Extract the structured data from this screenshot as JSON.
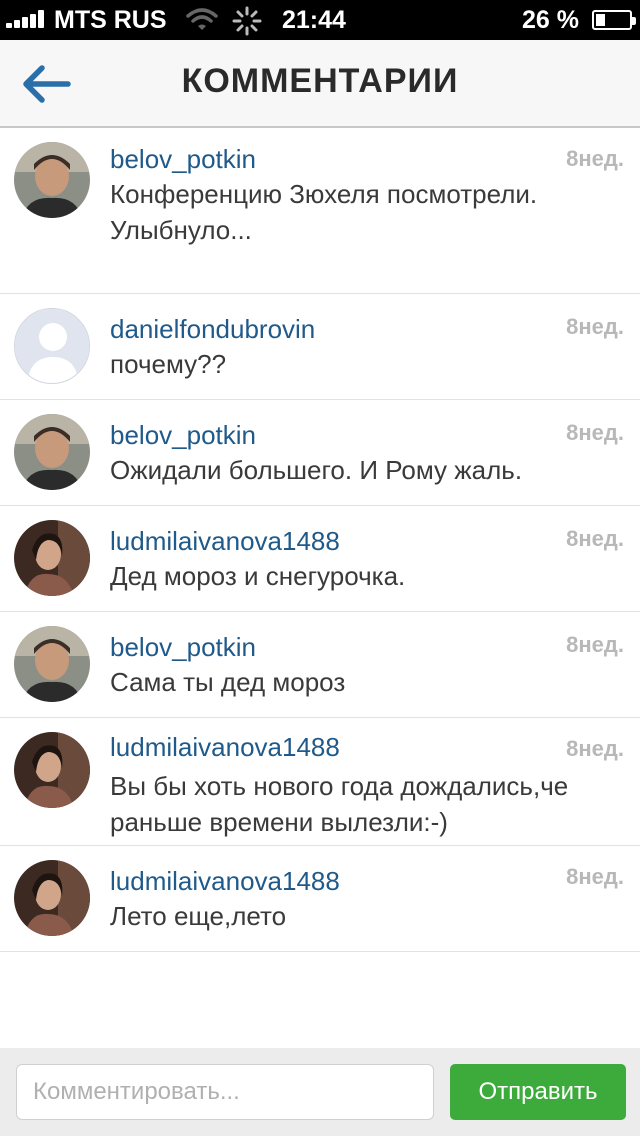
{
  "status_bar": {
    "carrier": "MTS RUS",
    "time": "21:44",
    "battery_percent": "26 %",
    "battery_level": 0.26
  },
  "header": {
    "title": "КОММЕНТАРИИ",
    "back_icon": "back-arrow-icon"
  },
  "comments": [
    {
      "username": "belov_potkin",
      "time": "8нед.",
      "text": "Конференцию Зюхеля посмотрели. Улыбнуло...",
      "avatar": "avatar-man"
    },
    {
      "username": "danielfondubrovin",
      "time": "8нед.",
      "text": "почему??",
      "avatar": "avatar-placeholder"
    },
    {
      "username": "belov_potkin",
      "time": "8нед.",
      "text": "Ожидали большего. И Рому жаль.",
      "avatar": "avatar-man"
    },
    {
      "username": "ludmilaivanova1488",
      "time": "8нед.",
      "text": "Дед мороз и снегурочка.",
      "avatar": "avatar-woman"
    },
    {
      "username": "belov_potkin",
      "time": "8нед.",
      "text": "Сама ты дед мороз",
      "avatar": "avatar-man"
    },
    {
      "username": "ludmilaivanova1488",
      "time": "8нед.",
      "text": "Вы бы хоть нового года дождались,че раньше времени вылезли:-)",
      "avatar": "avatar-woman"
    },
    {
      "username": "ludmilaivanova1488",
      "time": "8нед.",
      "text": "Лето еще,лето",
      "avatar": "avatar-woman"
    }
  ],
  "composer": {
    "placeholder": "Комментировать...",
    "value": "",
    "send_label": "Отправить"
  },
  "colors": {
    "username": "#1f5a8a",
    "send_button": "#3daa3c",
    "title": "#2a2a2a",
    "back_arrow": "#2a6fa8"
  }
}
